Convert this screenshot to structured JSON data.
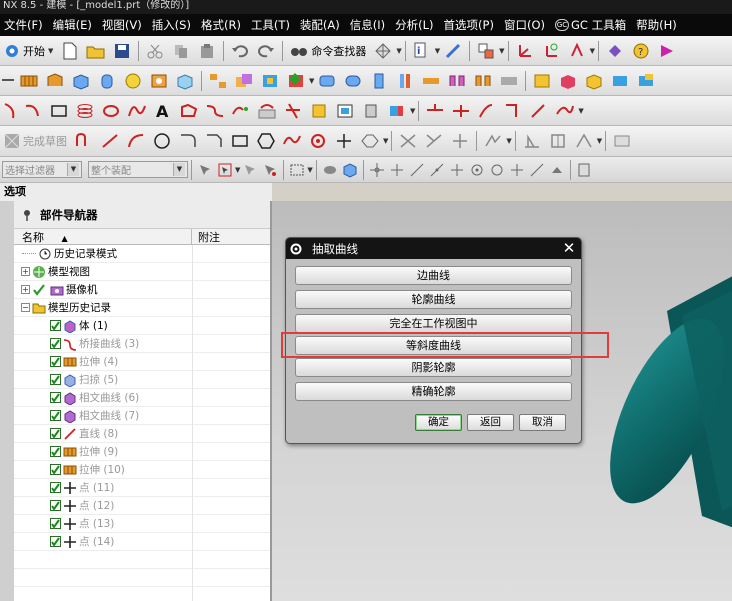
{
  "window": {
    "title": "NX 8.5 - 建模 - [_model1.prt（修改的）]"
  },
  "menubar": {
    "items": [
      "文件(F)",
      "编辑(E)",
      "视图(V)",
      "插入(S)",
      "格式(R)",
      "工具(T)",
      "装配(A)",
      "信息(I)",
      "分析(L)",
      "首选项(P)",
      "窗口(O)"
    ],
    "gc_label": "GC 工具箱",
    "help_label": "帮助(H)"
  },
  "toolbar1": {
    "start_label": "开始",
    "command_finder_label": "命令查找器"
  },
  "toolbar4": {
    "sketch_label": "完成草图"
  },
  "toolbar5": {
    "filter_combo": "选择过滤器",
    "scope_combo": "整个装配"
  },
  "resource_bar": {
    "label": "选项"
  },
  "navigator": {
    "title": "部件导航器",
    "col_name": "名称",
    "col_note": "附注",
    "rows": [
      {
        "label": "历史记录模式"
      },
      {
        "label": "模型视图"
      },
      {
        "label": "摄像机"
      },
      {
        "label": "模型历史记录"
      },
      {
        "label": "体",
        "num": "(1)"
      },
      {
        "label": "桥接曲线",
        "num": "(3)"
      },
      {
        "label": "拉伸",
        "num": "(4)"
      },
      {
        "label": "扫掠",
        "num": "(5)"
      },
      {
        "label": "相文曲线",
        "num": "(6)"
      },
      {
        "label": "相文曲线",
        "num": "(7)"
      },
      {
        "label": "直线",
        "num": "(8)"
      },
      {
        "label": "拉伸",
        "num": "(9)"
      },
      {
        "label": "拉伸",
        "num": "(10)"
      },
      {
        "label": "点",
        "num": "(11)"
      },
      {
        "label": "点",
        "num": "(12)"
      },
      {
        "label": "点",
        "num": "(13)"
      },
      {
        "label": "点",
        "num": "(14)"
      }
    ]
  },
  "dialog": {
    "title": "抽取曲线",
    "options": [
      "边曲线",
      "轮廓曲线",
      "完全在工作视图中",
      "等斜度曲线",
      "阴影轮廓",
      "精确轮廓"
    ],
    "ok_label": "确定",
    "back_label": "返回",
    "cancel_label": "取消"
  }
}
